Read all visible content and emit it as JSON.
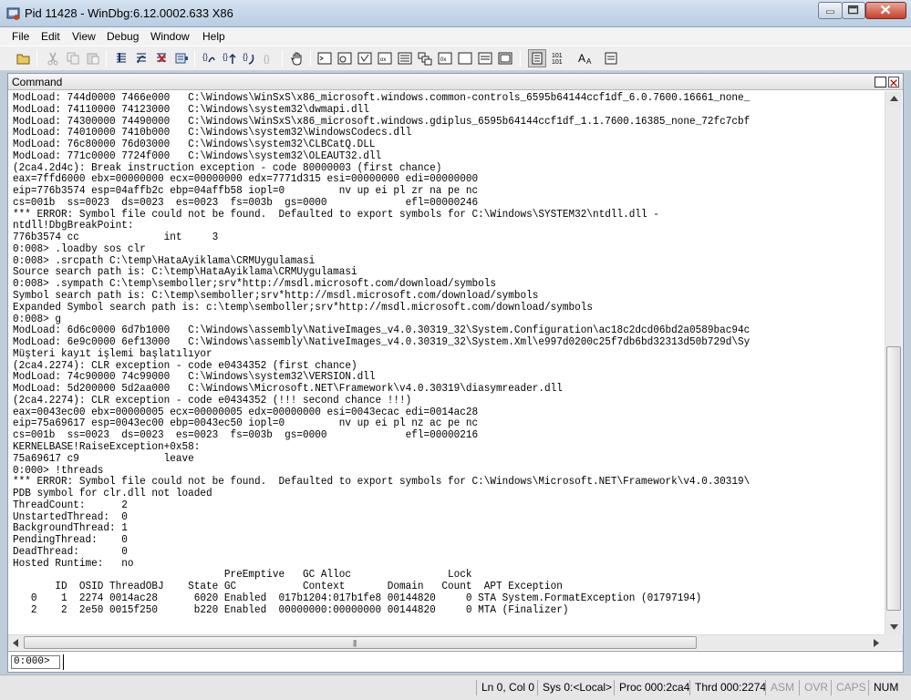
{
  "window": {
    "title": "Pid 11428 - WinDbg:6.12.0002.633 X86",
    "icon": "windbg-app-icon"
  },
  "menu": {
    "items": [
      "File",
      "Edit",
      "View",
      "Debug",
      "Window",
      "Help"
    ]
  },
  "toolbar": {
    "buttons": [
      "open-icon",
      "cut-icon",
      "copy-icon",
      "paste-icon",
      "step-into-icon",
      "step-over-icon",
      "stop-debugging-icon",
      "run-to-cursor-icon",
      "step-icon",
      "step-out-icon",
      "run-icon",
      "insert-breakpoint-icon",
      "hand-icon",
      "command-icon",
      "watch-icon",
      "locals-icon",
      "registers-icon",
      "memory-icon",
      "call-stack-icon",
      "disassembly-icon",
      "scratch-pad-icon",
      "processes-icon",
      "source-mode-icon",
      "hex-icon",
      "font-icon",
      "options-icon"
    ]
  },
  "command_window": {
    "title": "Command",
    "output_lines": [
      "ModLoad: 744d0000 7466e000   C:\\Windows\\WinSxS\\x86_microsoft.windows.common-controls_6595b64144ccf1df_6.0.7600.16661_none_",
      "ModLoad: 74110000 74123000   C:\\Windows\\system32\\dwmapi.dll",
      "ModLoad: 74300000 74490000   C:\\Windows\\WinSxS\\x86_microsoft.windows.gdiplus_6595b64144ccf1df_1.1.7600.16385_none_72fc7cbf",
      "ModLoad: 74010000 7410b000   C:\\Windows\\system32\\WindowsCodecs.dll",
      "ModLoad: 76c80000 76d03000   C:\\Windows\\system32\\CLBCatQ.DLL",
      "ModLoad: 771c0000 7724f000   C:\\Windows\\system32\\OLEAUT32.dll",
      "(2ca4.2d4c): Break instruction exception - code 80000003 (first chance)",
      "eax=7ffd6000 ebx=00000000 ecx=00000000 edx=7771d315 esi=00000000 edi=00000000",
      "eip=776b3574 esp=04affb2c ebp=04affb58 iopl=0         nv up ei pl zr na pe nc",
      "cs=001b  ss=0023  ds=0023  es=0023  fs=003b  gs=0000             efl=00000246",
      "*** ERROR: Symbol file could not be found.  Defaulted to export symbols for C:\\Windows\\SYSTEM32\\ntdll.dll -",
      "ntdll!DbgBreakPoint:",
      "776b3574 cc              int     3",
      "0:008> .loadby sos clr",
      "0:008> .srcpath C:\\temp\\HataAyiklama\\CRMUygulamasi",
      "Source search path is: C:\\temp\\HataAyiklama\\CRMUygulamasi",
      "0:008> .sympath C:\\temp\\semboller;srv*http://msdl.microsoft.com/download/symbols",
      "Symbol search path is: C:\\temp\\semboller;srv*http://msdl.microsoft.com/download/symbols",
      "Expanded Symbol search path is: c:\\temp\\semboller;srv*http://msdl.microsoft.com/download/symbols",
      "0:008> g",
      "ModLoad: 6d6c0000 6d7b1000   C:\\Windows\\assembly\\NativeImages_v4.0.30319_32\\System.Configuration\\ac18c2dcd06bd2a0589bac94c",
      "ModLoad: 6e9c0000 6ef13000   C:\\Windows\\assembly\\NativeImages_v4.0.30319_32\\System.Xml\\e997d0200c25f7db6bd32313d50b729d\\Sy",
      "Müşteri kayıt işlemi başlatılıyor",
      "(2ca4.2274): CLR exception - code e0434352 (first chance)",
      "ModLoad: 74c90000 74c99000   C:\\Windows\\system32\\VERSION.dll",
      "ModLoad: 5d200000 5d2aa000   C:\\Windows\\Microsoft.NET\\Framework\\v4.0.30319\\diasymreader.dll",
      "(2ca4.2274): CLR exception - code e0434352 (!!! second chance !!!)",
      "eax=0043ec00 ebx=00000005 ecx=00000005 edx=00000000 esi=0043ecac edi=0014ac28",
      "eip=75a69617 esp=0043ec00 ebp=0043ec50 iopl=0         nv up ei pl nz ac pe nc",
      "cs=001b  ss=0023  ds=0023  es=0023  fs=003b  gs=0000             efl=00000216",
      "KERNELBASE!RaiseException+0x58:",
      "75a69617 c9              leave",
      "0:000> !threads",
      "*** ERROR: Symbol file could not be found.  Defaulted to export symbols for C:\\Windows\\Microsoft.NET\\Framework\\v4.0.30319\\",
      "PDB symbol for clr.dll not loaded",
      "ThreadCount:      2",
      "UnstartedThread:  0",
      "BackgroundThread: 1",
      "PendingThread:    0",
      "DeadThread:       0",
      "Hosted Runtime:   no",
      "                                   PreEmptive   GC Alloc                Lock",
      "       ID  OSID ThreadOBJ    State GC           Context       Domain   Count  APT Exception",
      "   0    1  2274 0014ac28      6020 Enabled  017b1204:017b1fe8 00144820     0 STA System.FormatException (01797194)",
      "   2    2  2e50 0015f250      b220 Enabled  00000000:00000000 00144820     0 MTA (Finalizer)"
    ],
    "prompt": "0:000>",
    "input_value": ""
  },
  "statusbar": {
    "line_col": "Ln 0, Col 0",
    "sys": "Sys 0:<Local>",
    "proc": "Proc 000:2ca4",
    "thrd": "Thrd 000:2274",
    "asm": "ASM",
    "ovr": "OVR",
    "caps": "CAPS",
    "num": "NUM"
  }
}
